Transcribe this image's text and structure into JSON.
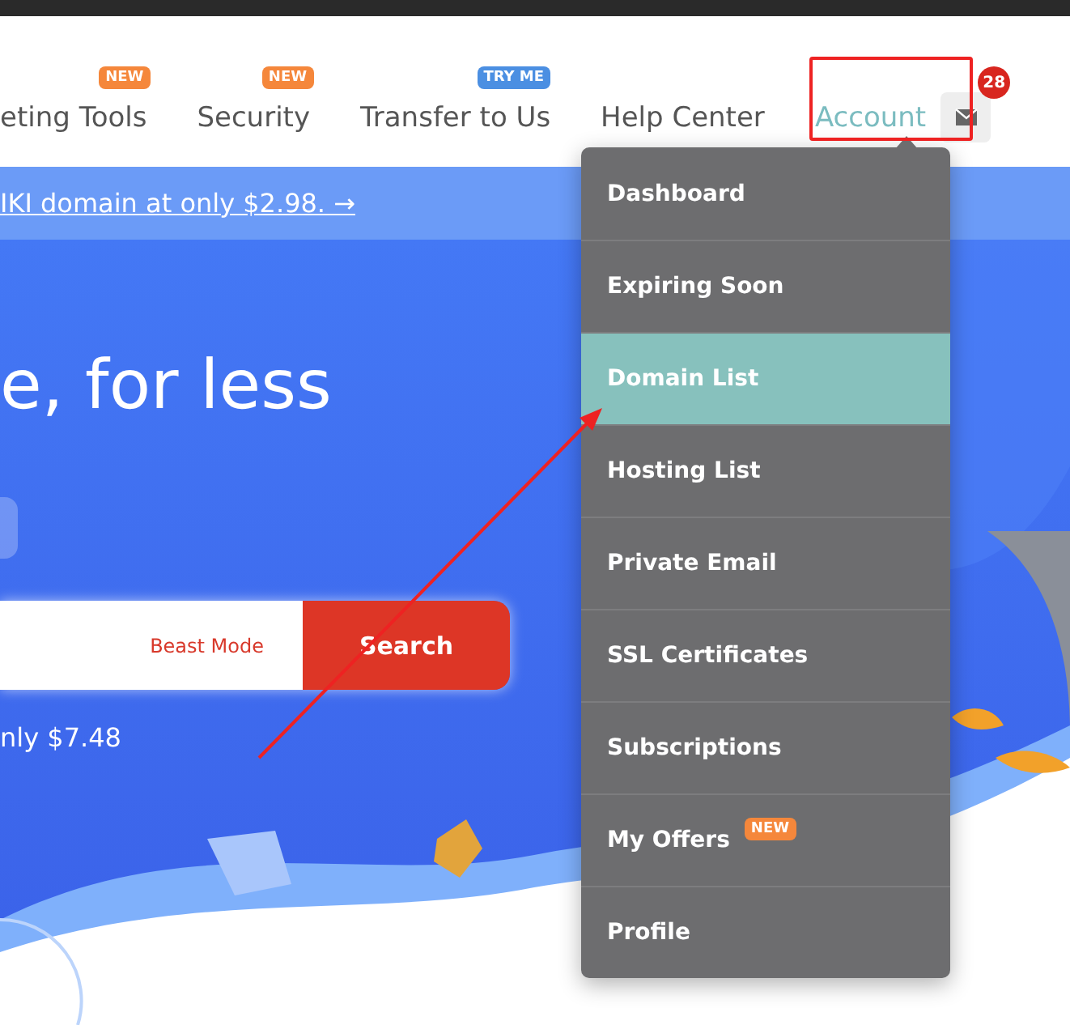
{
  "nav": {
    "items": [
      {
        "label": "eting Tools",
        "selected": false,
        "badge": {
          "text": "NEW",
          "color": "#f5873b"
        }
      },
      {
        "label": "Security",
        "selected": false,
        "badge": {
          "text": "NEW",
          "color": "#f5873b"
        }
      },
      {
        "label": "Transfer to Us",
        "selected": false,
        "badge": {
          "text": "TRY ME",
          "color": "#4b8fe2"
        }
      },
      {
        "label": "Help Center",
        "selected": false
      },
      {
        "label": "Account",
        "selected": true
      }
    ],
    "mail": {
      "count": "28"
    }
  },
  "banner": {
    "link": "IKI domain at only $2.98. →"
  },
  "hero": {
    "title": "e, for less",
    "search": {
      "mode": "Beast Mode",
      "button": "Search"
    },
    "price": "nly $7.48"
  },
  "account_menu": {
    "items": [
      {
        "label": "Dashboard",
        "selected": false
      },
      {
        "label": "Expiring Soon",
        "selected": false
      },
      {
        "label": "Domain List",
        "selected": true
      },
      {
        "label": "Hosting List",
        "selected": false
      },
      {
        "label": "Private Email",
        "selected": false
      },
      {
        "label": "SSL Certificates",
        "selected": false
      },
      {
        "label": "Subscriptions",
        "selected": false
      },
      {
        "label": "My Offers",
        "selected": false,
        "badge": {
          "text": "NEW",
          "color": "#f5873b"
        }
      },
      {
        "label": "Profile",
        "selected": false
      }
    ]
  }
}
